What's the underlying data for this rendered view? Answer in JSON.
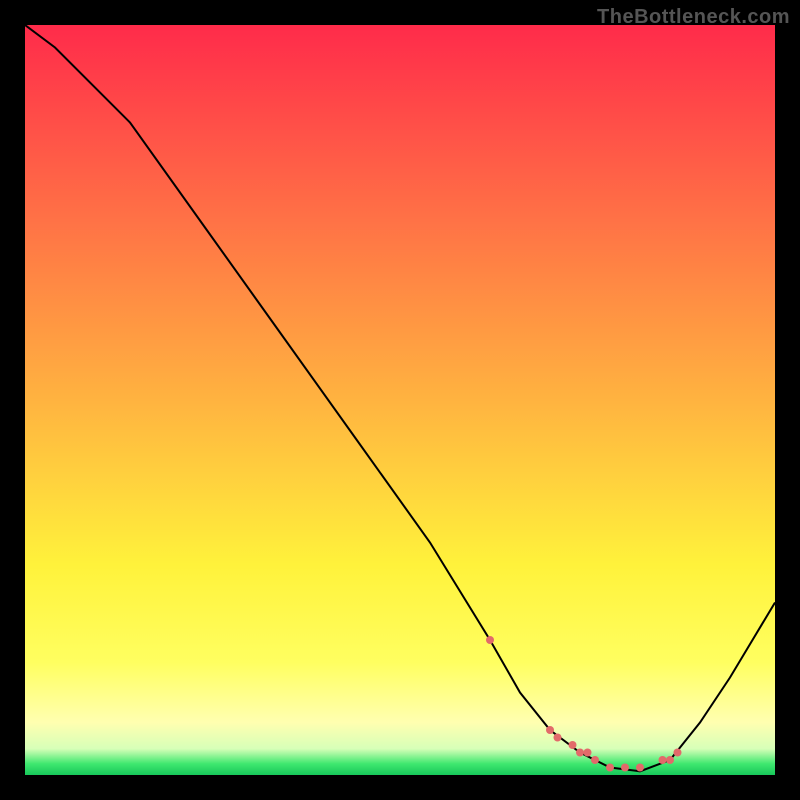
{
  "watermark": "TheBottleneck.com",
  "colors": {
    "background_black": "#000000",
    "curve": "#000000",
    "marker": "#e26a6a",
    "gradient_stops": [
      {
        "offset": 0.0,
        "color": "#ff2b4a"
      },
      {
        "offset": 0.25,
        "color": "#ff6f46"
      },
      {
        "offset": 0.5,
        "color": "#ffb340"
      },
      {
        "offset": 0.72,
        "color": "#fff23b"
      },
      {
        "offset": 0.85,
        "color": "#ffff60"
      },
      {
        "offset": 0.93,
        "color": "#ffffb0"
      },
      {
        "offset": 0.965,
        "color": "#d7ffb8"
      },
      {
        "offset": 0.985,
        "color": "#3fe86f"
      },
      {
        "offset": 1.0,
        "color": "#17c75a"
      }
    ]
  },
  "chart_data": {
    "type": "line",
    "title": "",
    "xlabel": "",
    "ylabel": "",
    "xlim": [
      0,
      100
    ],
    "ylim": [
      0,
      100
    ],
    "x": [
      0,
      4,
      14,
      24,
      34,
      44,
      54,
      62,
      66,
      70,
      74,
      78,
      82,
      86,
      90,
      94,
      100
    ],
    "values": [
      100,
      97,
      87,
      73,
      59,
      45,
      31,
      18,
      11,
      6,
      3,
      1,
      0.5,
      2,
      7,
      13,
      23
    ],
    "marker_points": [
      {
        "x": 62,
        "y": 18
      },
      {
        "x": 70,
        "y": 6
      },
      {
        "x": 71,
        "y": 5
      },
      {
        "x": 73,
        "y": 4
      },
      {
        "x": 74,
        "y": 3
      },
      {
        "x": 75,
        "y": 3
      },
      {
        "x": 76,
        "y": 2
      },
      {
        "x": 78,
        "y": 1
      },
      {
        "x": 80,
        "y": 1
      },
      {
        "x": 82,
        "y": 1
      },
      {
        "x": 85,
        "y": 2
      },
      {
        "x": 86,
        "y": 2
      },
      {
        "x": 87,
        "y": 3
      }
    ],
    "marker_radius": 4,
    "legend": []
  }
}
